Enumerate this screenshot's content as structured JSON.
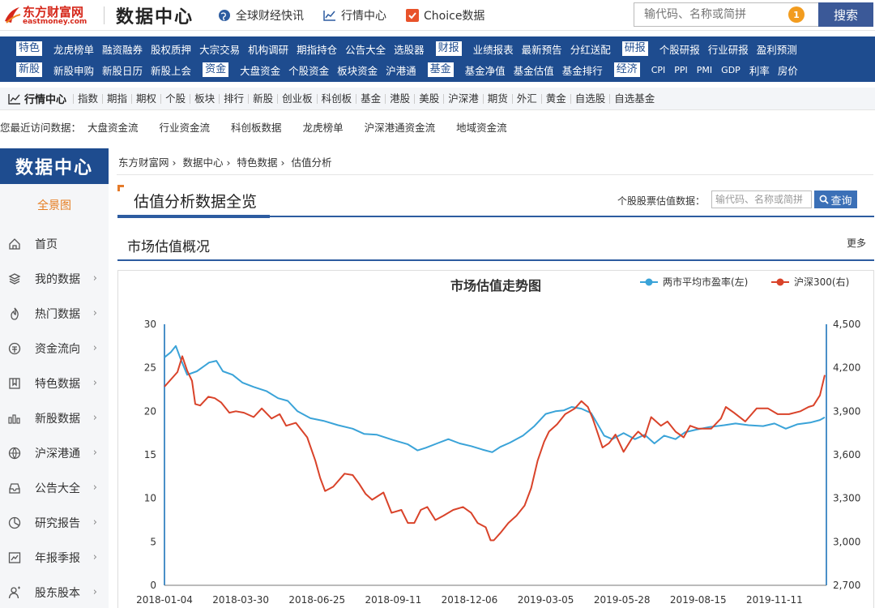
{
  "header": {
    "logo_cn": "东方财富网",
    "logo_en": "eastmoney.com",
    "title": "数据中心",
    "links": [
      "全球财经快讯",
      "行情中心",
      "Choice数据"
    ],
    "search_placeholder": "输代码、名称或简拼",
    "search_badge": "1",
    "search_button": "搜索"
  },
  "bluenav": {
    "row1": [
      {
        "tag": "特色",
        "items": [
          "龙虎榜单",
          "融资融券",
          "股权质押",
          "大宗交易",
          "机构调研",
          "期指持仓",
          "公告大全",
          "选股器"
        ]
      },
      {
        "tag": "财报",
        "items": [
          "业绩报表",
          "最新预告",
          "分红送配"
        ]
      },
      {
        "tag": "研报",
        "items": [
          "个股研报",
          "行业研报",
          "盈利预测"
        ]
      }
    ],
    "row2": [
      {
        "tag": "新股",
        "items": [
          "新股申购",
          "新股日历",
          "新股上会"
        ]
      },
      {
        "tag": "资金",
        "items": [
          "大盘资金",
          "个股资金",
          "板块资金",
          "沪港通"
        ]
      },
      {
        "tag": "基金",
        "items": [
          "基金净值",
          "基金估值",
          "基金排行"
        ]
      },
      {
        "tag": "经济",
        "items": [
          "CPI",
          "PPI",
          "PMI",
          "GDP",
          "利率",
          "房价"
        ]
      }
    ]
  },
  "nav3": {
    "title": "行情中心",
    "items": [
      "指数",
      "期指",
      "期权",
      "个股",
      "板块",
      "排行",
      "新股",
      "创业板",
      "科创板",
      "基金",
      "港股",
      "美股",
      "沪深港",
      "期货",
      "外汇",
      "黄金",
      "自选股",
      "自选基金"
    ]
  },
  "recent": {
    "label": "您最近访问数据：",
    "items": [
      "大盘资金流",
      "行业资金流",
      "科创板数据",
      "龙虎榜单",
      "沪深港通资金流",
      "地域资金流"
    ]
  },
  "sidebar": {
    "title": "数据中心",
    "overview": "全景图",
    "items": [
      {
        "label": "首页",
        "icon": "home-icon",
        "arrow": false
      },
      {
        "label": "我的数据",
        "icon": "layers-icon",
        "arrow": true
      },
      {
        "label": "热门数据",
        "icon": "flame-icon",
        "arrow": true
      },
      {
        "label": "资金流向",
        "icon": "currency-icon",
        "arrow": true
      },
      {
        "label": "特色数据",
        "icon": "bookmark-icon",
        "arrow": true
      },
      {
        "label": "新股数据",
        "icon": "bars-icon",
        "arrow": true
      },
      {
        "label": "沪深港通",
        "icon": "globe-icon",
        "arrow": true
      },
      {
        "label": "公告大全",
        "icon": "inbox-icon",
        "arrow": true
      },
      {
        "label": "研究报告",
        "icon": "pie-icon",
        "arrow": true
      },
      {
        "label": "年报季报",
        "icon": "report-icon",
        "arrow": true
      },
      {
        "label": "股东股本",
        "icon": "user-icon",
        "arrow": true
      }
    ]
  },
  "breadcrumb": [
    "东方财富网",
    "数据中心",
    "特色数据",
    "估值分析"
  ],
  "section": {
    "title": "估值分析数据全览",
    "stock_label": "个股股票估值数据：",
    "stock_placeholder": "输代码、名称或简拼",
    "stock_button": "查询",
    "subtitle": "市场估值概况",
    "more": "更多"
  },
  "chart_data": {
    "type": "line",
    "title": "市场估值走势图",
    "x_ticks": [
      "2018-01-04",
      "2018-03-30",
      "2018-06-25",
      "2018-09-11",
      "2018-12-06",
      "2019-03-05",
      "2019-05-28",
      "2019-08-15",
      "2019-11-11"
    ],
    "y_left": {
      "min": 0,
      "max": 30,
      "ticks": [
        "0",
        "5",
        "10",
        "15",
        "20",
        "25",
        "30"
      ]
    },
    "y_right": {
      "min": 2700,
      "max": 4500,
      "ticks": [
        "2,700",
        "3,000",
        "3,300",
        "3,600",
        "3,900",
        "4,200",
        "4,500"
      ]
    },
    "grid": false,
    "legend_position": "top-right",
    "series": [
      {
        "name": "两市平均市盈率(左)",
        "color": "#3aa3d8",
        "axis": "left",
        "points": [
          [
            0,
            26.2
          ],
          [
            8,
            26.8
          ],
          [
            14,
            27.5
          ],
          [
            20,
            26.0
          ],
          [
            28,
            24.2
          ],
          [
            40,
            24.6
          ],
          [
            55,
            25.6
          ],
          [
            64,
            25.8
          ],
          [
            72,
            24.6
          ],
          [
            84,
            24.2
          ],
          [
            96,
            23.3
          ],
          [
            110,
            22.8
          ],
          [
            126,
            22.3
          ],
          [
            140,
            21.5
          ],
          [
            152,
            21.2
          ],
          [
            164,
            20.0
          ],
          [
            180,
            19.2
          ],
          [
            196,
            18.9
          ],
          [
            214,
            18.4
          ],
          [
            232,
            18.0
          ],
          [
            246,
            17.4
          ],
          [
            262,
            17.3
          ],
          [
            282,
            16.7
          ],
          [
            300,
            16.2
          ],
          [
            312,
            15.5
          ],
          [
            322,
            15.8
          ],
          [
            336,
            16.3
          ],
          [
            350,
            16.8
          ],
          [
            364,
            16.3
          ],
          [
            378,
            16.0
          ],
          [
            392,
            15.6
          ],
          [
            404,
            15.3
          ],
          [
            414,
            15.9
          ],
          [
            426,
            16.4
          ],
          [
            442,
            17.2
          ],
          [
            456,
            18.3
          ],
          [
            470,
            19.7
          ],
          [
            482,
            20.0
          ],
          [
            492,
            20.1
          ],
          [
            502,
            20.5
          ],
          [
            514,
            20.3
          ],
          [
            526,
            19.8
          ],
          [
            534,
            18.5
          ],
          [
            542,
            17.2
          ],
          [
            552,
            16.8
          ],
          [
            566,
            17.5
          ],
          [
            580,
            16.8
          ],
          [
            592,
            17.3
          ],
          [
            604,
            16.3
          ],
          [
            616,
            17.2
          ],
          [
            630,
            16.8
          ],
          [
            642,
            17.6
          ],
          [
            656,
            17.9
          ],
          [
            672,
            18.2
          ],
          [
            690,
            18.4
          ],
          [
            704,
            18.6
          ],
          [
            720,
            18.4
          ],
          [
            738,
            18.3
          ],
          [
            752,
            18.6
          ],
          [
            766,
            18.0
          ],
          [
            780,
            18.5
          ],
          [
            796,
            18.7
          ],
          [
            808,
            19.0
          ],
          [
            814,
            19.3
          ]
        ]
      },
      {
        "name": "沪深300(右)",
        "color": "#d9432a",
        "axis": "right",
        "points": [
          [
            0,
            4070
          ],
          [
            8,
            4120
          ],
          [
            16,
            4170
          ],
          [
            22,
            4280
          ],
          [
            28,
            4180
          ],
          [
            34,
            4110
          ],
          [
            38,
            3950
          ],
          [
            44,
            3940
          ],
          [
            54,
            4000
          ],
          [
            62,
            3990
          ],
          [
            70,
            3960
          ],
          [
            80,
            3890
          ],
          [
            88,
            3900
          ],
          [
            98,
            3890
          ],
          [
            110,
            3860
          ],
          [
            120,
            3920
          ],
          [
            132,
            3850
          ],
          [
            142,
            3880
          ],
          [
            150,
            3800
          ],
          [
            162,
            3820
          ],
          [
            176,
            3720
          ],
          [
            186,
            3560
          ],
          [
            192,
            3440
          ],
          [
            198,
            3350
          ],
          [
            208,
            3380
          ],
          [
            222,
            3470
          ],
          [
            232,
            3460
          ],
          [
            240,
            3400
          ],
          [
            248,
            3330
          ],
          [
            256,
            3290
          ],
          [
            270,
            3340
          ],
          [
            280,
            3200
          ],
          [
            292,
            3220
          ],
          [
            300,
            3130
          ],
          [
            308,
            3130
          ],
          [
            316,
            3220
          ],
          [
            324,
            3240
          ],
          [
            334,
            3150
          ],
          [
            344,
            3180
          ],
          [
            356,
            3220
          ],
          [
            368,
            3240
          ],
          [
            378,
            3200
          ],
          [
            386,
            3130
          ],
          [
            396,
            3100
          ],
          [
            402,
            3010
          ],
          [
            406,
            3010
          ],
          [
            414,
            3060
          ],
          [
            424,
            3130
          ],
          [
            434,
            3180
          ],
          [
            444,
            3250
          ],
          [
            452,
            3370
          ],
          [
            460,
            3560
          ],
          [
            468,
            3690
          ],
          [
            474,
            3760
          ],
          [
            484,
            3810
          ],
          [
            494,
            3880
          ],
          [
            506,
            3920
          ],
          [
            514,
            3970
          ],
          [
            522,
            3930
          ],
          [
            528,
            3850
          ],
          [
            534,
            3750
          ],
          [
            540,
            3650
          ],
          [
            548,
            3680
          ],
          [
            556,
            3740
          ],
          [
            566,
            3620
          ],
          [
            576,
            3710
          ],
          [
            584,
            3760
          ],
          [
            592,
            3720
          ],
          [
            600,
            3860
          ],
          [
            612,
            3800
          ],
          [
            620,
            3830
          ],
          [
            630,
            3760
          ],
          [
            640,
            3720
          ],
          [
            648,
            3800
          ],
          [
            658,
            3780
          ],
          [
            666,
            3780
          ],
          [
            674,
            3780
          ],
          [
            686,
            3850
          ],
          [
            692,
            3930
          ],
          [
            702,
            3890
          ],
          [
            716,
            3830
          ],
          [
            730,
            3920
          ],
          [
            744,
            3920
          ],
          [
            756,
            3880
          ],
          [
            770,
            3880
          ],
          [
            784,
            3900
          ],
          [
            794,
            3930
          ],
          [
            800,
            3940
          ],
          [
            808,
            4010
          ],
          [
            814,
            4150
          ]
        ]
      }
    ]
  }
}
